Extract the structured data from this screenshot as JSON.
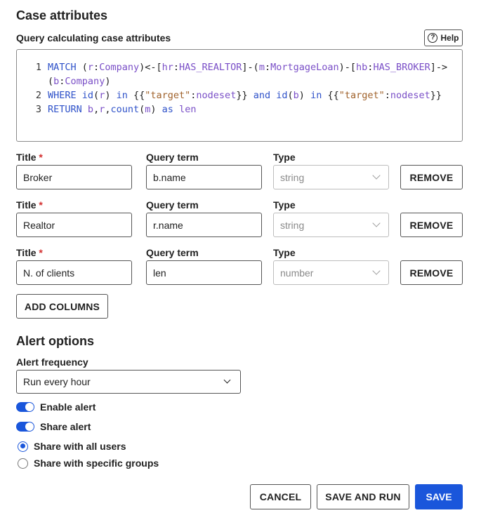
{
  "case_attributes": {
    "title": "Case attributes",
    "query_label": "Query calculating case attributes",
    "help_label": "Help",
    "help_icon": "question-circle-icon",
    "query_lines": [
      {
        "number": "1",
        "text": "MATCH (r:Company)<-[hr:HAS_REALTOR]-(m:MortgageLoan)-[hb:HAS_BROKER]->"
      },
      {
        "number": "",
        "text": "(b:Company)"
      },
      {
        "number": "2",
        "text": "WHERE id(r) in {{\"target\":nodeset}} and id(b) in {{\"target\":nodeset}}"
      },
      {
        "number": "3",
        "text": "RETURN b,r,count(m) as len"
      }
    ],
    "columns": [
      {
        "title_label": "Title",
        "required_mark": "*",
        "title_value": "Broker",
        "term_label": "Query term",
        "term_value": "b.name",
        "type_label": "Type",
        "type_value": "string",
        "remove_label": "REMOVE"
      },
      {
        "title_label": "Title",
        "required_mark": "*",
        "title_value": "Realtor",
        "term_label": "Query term",
        "term_value": "r.name",
        "type_label": "Type",
        "type_value": "string",
        "remove_label": "REMOVE"
      },
      {
        "title_label": "Title",
        "required_mark": "*",
        "title_value": "N. of clients",
        "term_label": "Query term",
        "term_value": "len",
        "type_label": "Type",
        "type_value": "number",
        "remove_label": "REMOVE"
      }
    ],
    "add_columns_label": "ADD COLUMNS"
  },
  "alert_options": {
    "title": "Alert options",
    "frequency_label": "Alert frequency",
    "frequency_value": "Run every hour",
    "enable_alert_label": "Enable alert",
    "enable_alert_on": true,
    "share_alert_label": "Share alert",
    "share_alert_on": true,
    "share_all_label": "Share with all users",
    "share_groups_label": "Share with specific groups",
    "selected_share": "all"
  },
  "footer": {
    "cancel_label": "CANCEL",
    "save_run_label": "SAVE AND RUN",
    "save_label": "SAVE"
  },
  "colors": {
    "accent": "#1a56db",
    "required": "#d32f2f",
    "keyword": "#2f52c9",
    "identifier": "#7a4fc7",
    "string": "#a0622b"
  }
}
